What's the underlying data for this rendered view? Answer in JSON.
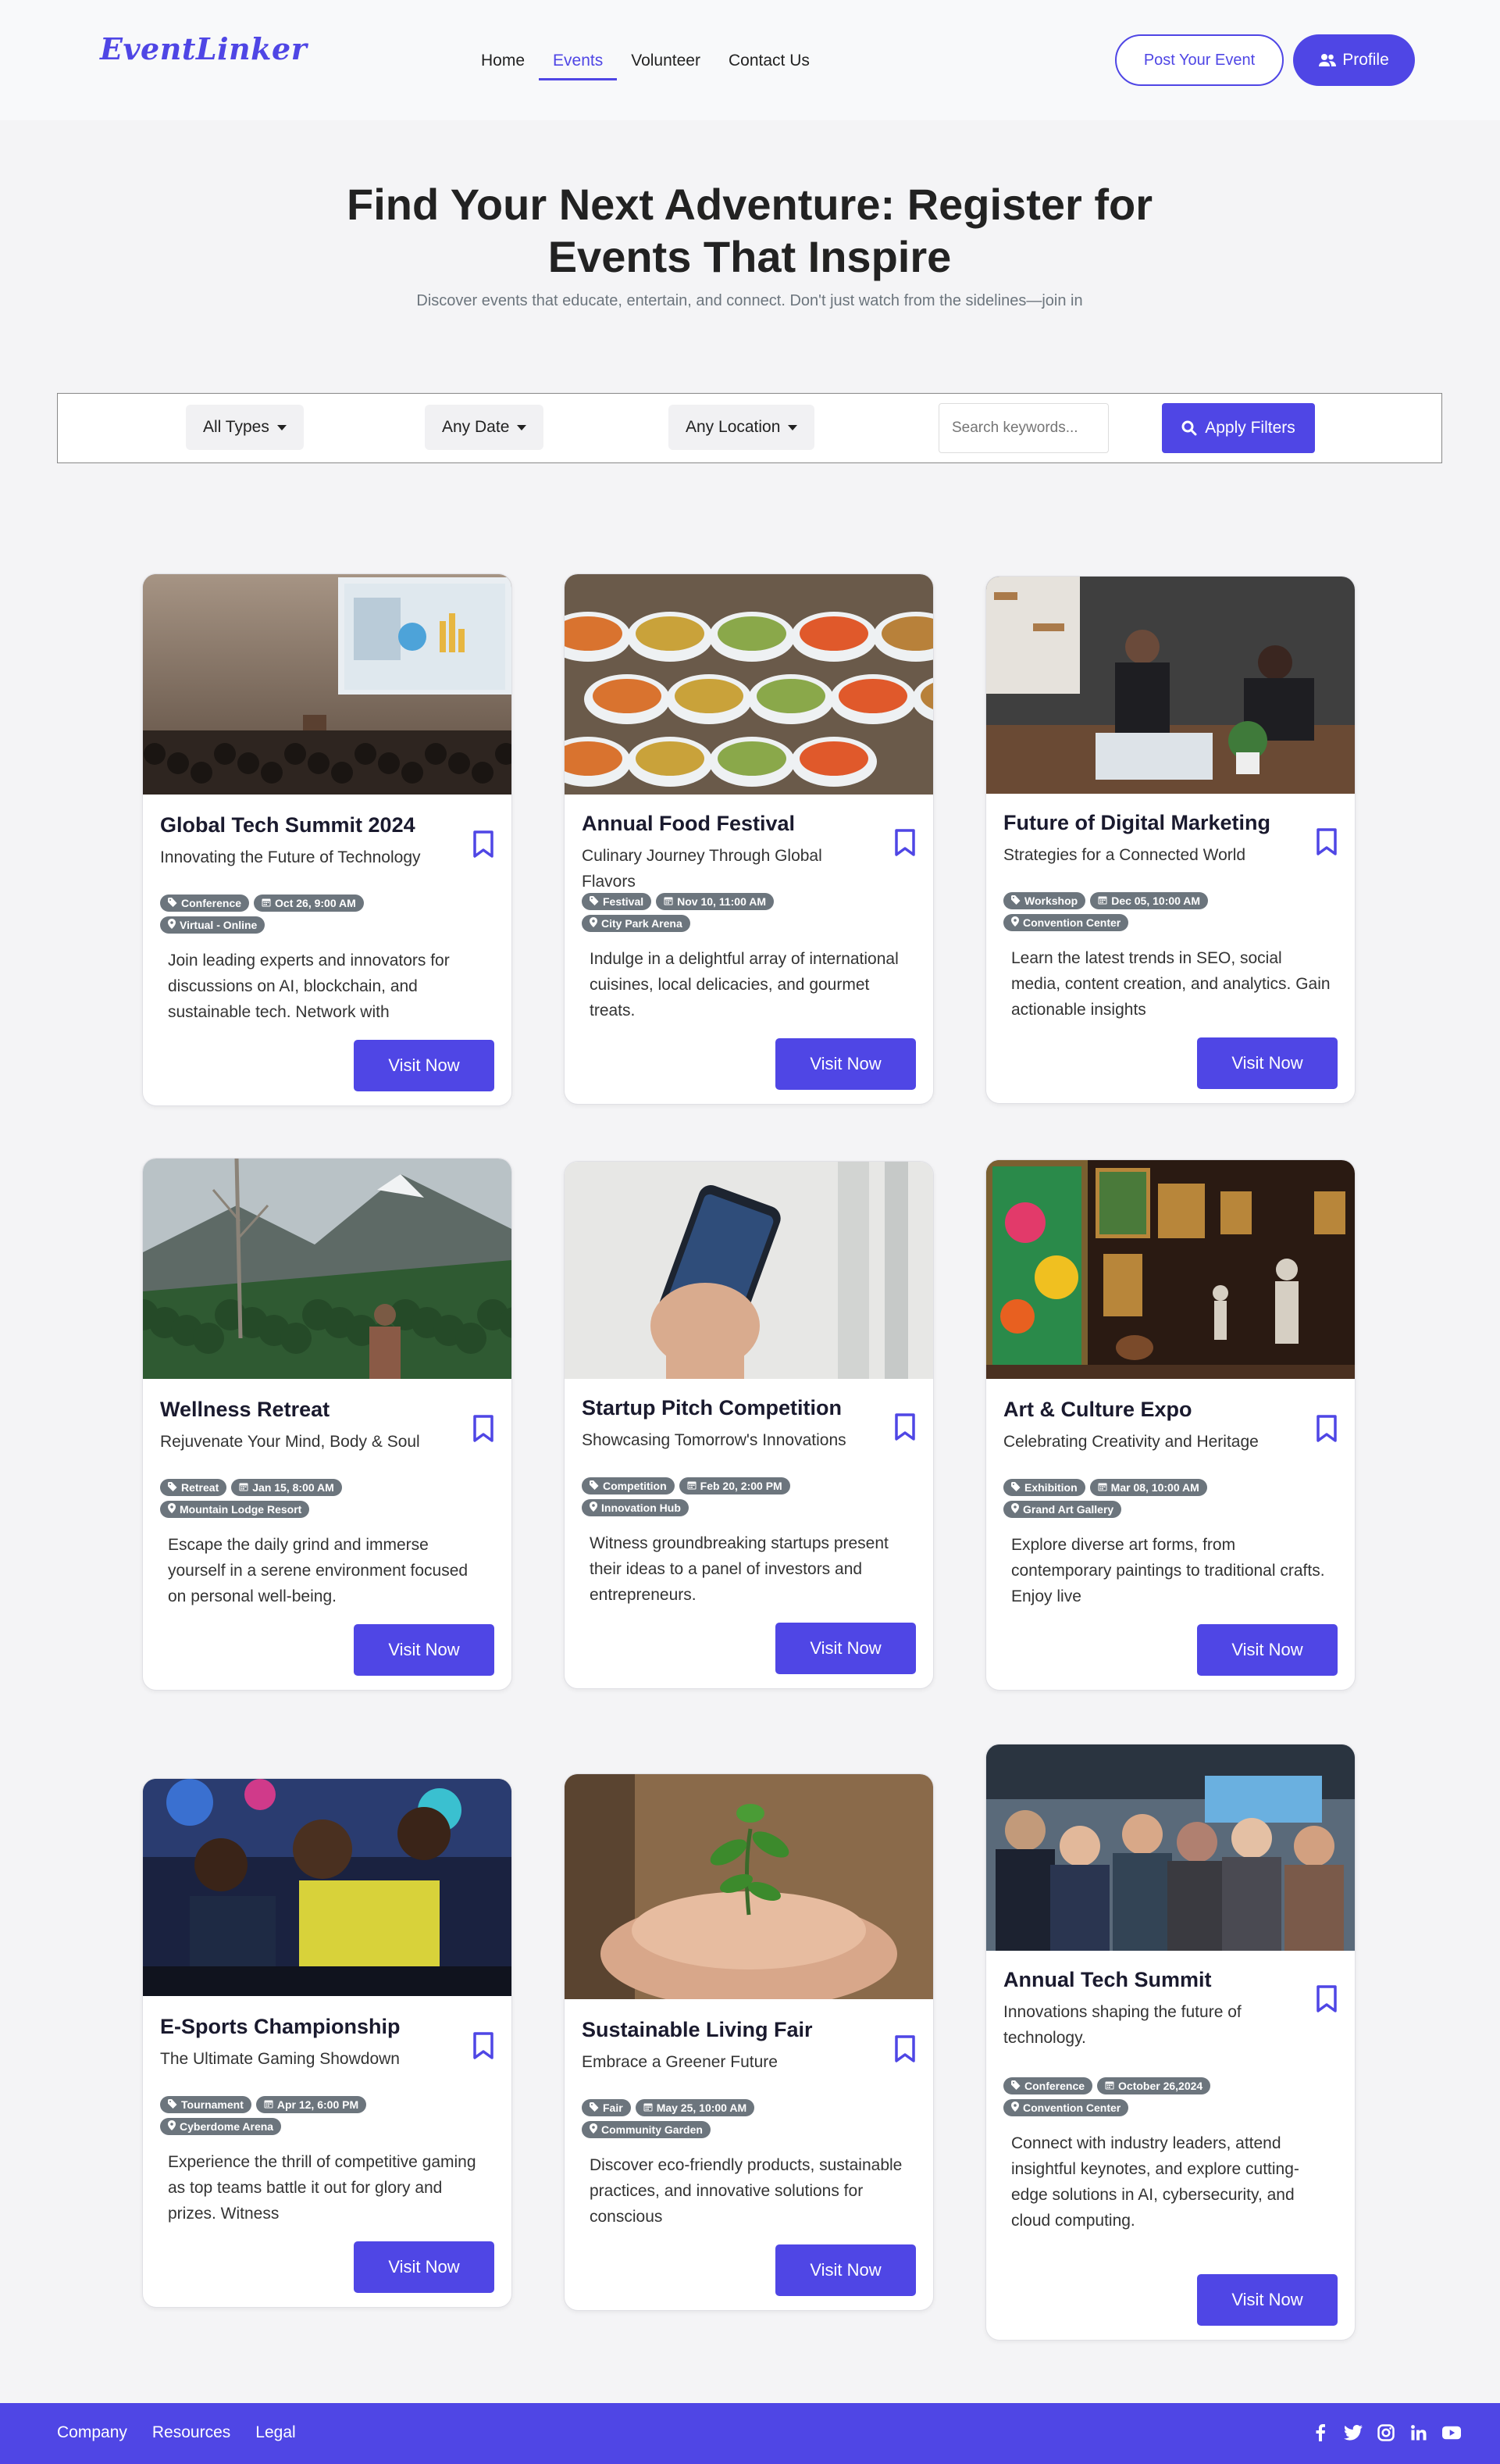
{
  "brand": "EventLinker",
  "nav": [
    {
      "label": "Home",
      "active": false
    },
    {
      "label": "Events",
      "active": true
    },
    {
      "label": "Volunteer",
      "active": false
    },
    {
      "label": "Contact Us",
      "active": false
    }
  ],
  "header_buttons": {
    "post": "Post Your Event",
    "profile": "Profile"
  },
  "hero": {
    "title": "Find Your Next Adventure: Register for Events That Inspire",
    "subtitle": "Discover events that educate, entertain, and connect. Don't just watch from the sidelines—join in"
  },
  "filters": {
    "type": "All Types",
    "date": "Any Date",
    "location": "Any Location",
    "search_placeholder": "Search keywords...",
    "apply": "Apply Filters"
  },
  "cards": [
    {
      "title": "Global Tech Summit 2024",
      "subtitle": "Innovating the Future of Technology",
      "type": "Conference",
      "date": "Oct 26, 9:00 AM",
      "location": "Virtual - Online",
      "description": "Join leading experts and innovators for discussions on AI, blockchain, and sustainable tech. Network with",
      "button": "Visit Now",
      "image": "conference-presentation"
    },
    {
      "title": "Annual Food Festival",
      "subtitle": "Culinary Journey Through Global Flavors",
      "type": "Festival",
      "date": "Nov 10, 11:00 AM",
      "location": "City Park Arena",
      "description": "Indulge in a delightful array of international cuisines, local delicacies, and gourmet treats.",
      "button": "Visit Now",
      "image": "food-bowls"
    },
    {
      "title": "Future of Digital Marketing",
      "subtitle": "Strategies for a Connected World",
      "type": "Workshop",
      "date": "Dec 05, 10:00 AM",
      "location": "Convention Center",
      "description": "Learn the latest trends in SEO, social media, content creation, and analytics. Gain actionable insights",
      "button": "Visit Now",
      "image": "office-meeting"
    },
    {
      "title": "Wellness Retreat",
      "subtitle": "Rejuvenate Your Mind, Body & Soul",
      "type": "Retreat",
      "date": "Jan 15, 8:00 AM",
      "location": "Mountain Lodge Resort",
      "description": "Escape the daily grind and immerse yourself in a serene environment focused on personal well-being.",
      "button": "Visit Now",
      "image": "mountain-landscape"
    },
    {
      "title": "Startup Pitch Competition",
      "subtitle": "Showcasing Tomorrow's Innovations",
      "type": "Competition",
      "date": "Feb 20, 2:00 PM",
      "location": "Innovation Hub",
      "description": "Witness groundbreaking startups present their ideas to a panel of investors and entrepreneurs.",
      "button": "Visit Now",
      "image": "hand-phone"
    },
    {
      "title": "Art & Culture Expo",
      "subtitle": "Celebrating Creativity and Heritage",
      "type": "Exhibition",
      "date": "Mar 08, 10:00 AM",
      "location": "Grand Art Gallery",
      "description": "Explore diverse art forms, from contemporary paintings to traditional crafts. Enjoy live",
      "button": "Visit Now",
      "image": "art-gallery"
    },
    {
      "title": "E-Sports Championship",
      "subtitle": "The Ultimate Gaming Showdown",
      "type": "Tournament",
      "date": "Apr 12, 6:00 PM",
      "location": "Cyberdome Arena",
      "description": "Experience the thrill of competitive gaming as top teams battle it out for glory and prizes. Witness",
      "button": "Visit Now",
      "image": "gamers"
    },
    {
      "title": "Sustainable Living Fair",
      "subtitle": "Embrace a Greener Future",
      "type": "Fair",
      "date": "May 25, 10:00 AM",
      "location": "Community Garden",
      "description": "Discover eco-friendly products, sustainable practices, and innovative solutions for conscious",
      "button": "Visit Now",
      "image": "hands-plant"
    },
    {
      "title": "Annual Tech Summit",
      "subtitle": "Innovations shaping the future of technology.",
      "type": "Conference",
      "date": "October 26,2024",
      "location": "Convention Center",
      "description": "Connect with industry leaders, attend insightful keynotes, and explore cutting-edge solutions in AI, cybersecurity, and cloud computing.",
      "button": "Visit Now",
      "image": "networking-crowd"
    }
  ],
  "footer": {
    "links": [
      "Company",
      "Resources",
      "Legal"
    ],
    "socials": [
      "facebook-icon",
      "twitter-icon",
      "instagram-icon",
      "linkedin-icon",
      "youtube-icon"
    ]
  },
  "colors": {
    "accent": "#4f46e5",
    "tag": "#6c757d"
  }
}
